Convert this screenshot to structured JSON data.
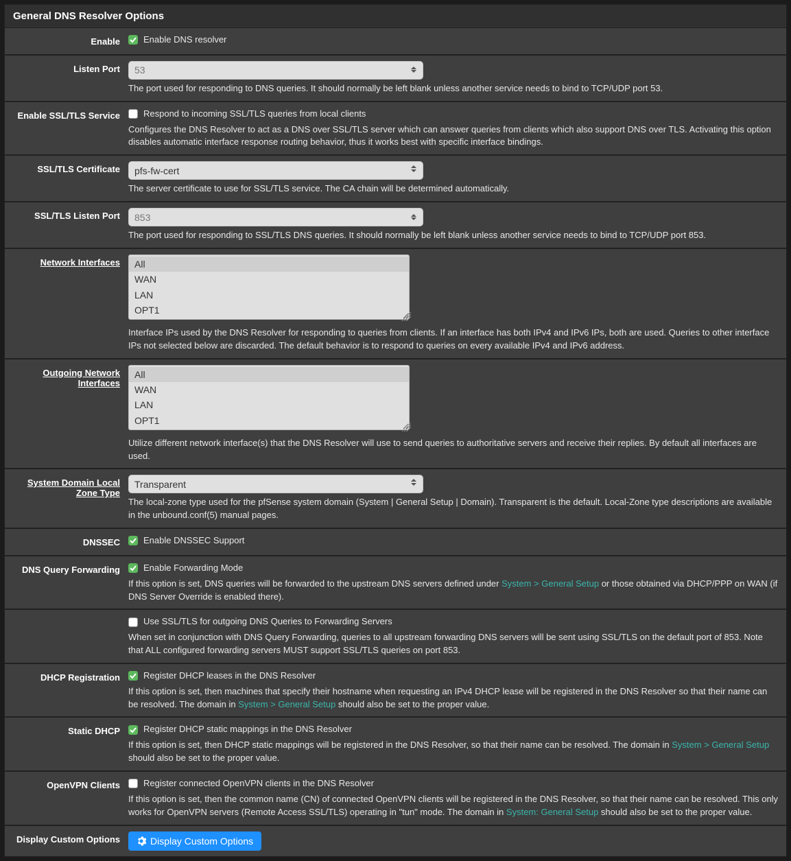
{
  "panel": {
    "title": "General DNS Resolver Options"
  },
  "fields": {
    "enable": {
      "label": "Enable",
      "check_label": "Enable DNS resolver",
      "checked": true
    },
    "listen_port": {
      "label": "Listen Port",
      "placeholder": "53",
      "value": "",
      "help": "The port used for responding to DNS queries. It should normally be left blank unless another service needs to bind to TCP/UDP port 53."
    },
    "enable_ssl": {
      "label": "Enable SSL/TLS Service",
      "check_label": "Respond to incoming SSL/TLS queries from local clients",
      "checked": false,
      "help": "Configures the DNS Resolver to act as a DNS over SSL/TLS server which can answer queries from clients which also support DNS over TLS. Activating this option disables automatic interface response routing behavior, thus it works best with specific interface bindings."
    },
    "ssl_cert": {
      "label": "SSL/TLS Certificate",
      "selected": "pfs-fw-cert",
      "help": "The server certificate to use for SSL/TLS service. The CA chain will be determined automatically."
    },
    "ssl_port": {
      "label": "SSL/TLS Listen Port",
      "placeholder": "853",
      "value": "",
      "help": "The port used for responding to SSL/TLS DNS queries. It should normally be left blank unless another service needs to bind to TCP/UDP port 853."
    },
    "net_if": {
      "label": "Network Interfaces",
      "options": [
        "All",
        "WAN",
        "LAN",
        "OPT1"
      ],
      "selected": [
        "All"
      ],
      "help": "Interface IPs used by the DNS Resolver for responding to queries from clients. If an interface has both IPv4 and IPv6 IPs, both are used. Queries to other interface IPs not selected below are discarded. The default behavior is to respond to queries on every available IPv4 and IPv6 address."
    },
    "out_if": {
      "label": "Outgoing Network Interfaces",
      "options": [
        "All",
        "WAN",
        "LAN",
        "OPT1"
      ],
      "selected": [
        "All"
      ],
      "help": "Utilize different network interface(s) that the DNS Resolver will use to send queries to authoritative servers and receive their replies. By default all interfaces are used."
    },
    "zone_type": {
      "label": "System Domain Local Zone Type",
      "selected": "Transparent",
      "help": "The local-zone type used for the pfSense system domain (System | General Setup | Domain). Transparent is the default. Local-Zone type descriptions are available in the unbound.conf(5) manual pages."
    },
    "dnssec": {
      "label": "DNSSEC",
      "check_label": "Enable DNSSEC Support",
      "checked": true
    },
    "forwarding": {
      "label": "DNS Query Forwarding",
      "check_label": "Enable Forwarding Mode",
      "checked": true,
      "help_pre": "If this option is set, DNS queries will be forwarded to the upstream DNS servers defined under ",
      "help_link": "System > General Setup",
      "help_post": " or those obtained via DHCP/PPP on WAN (if DNS Server Override is enabled there)."
    },
    "fwd_ssl": {
      "label": "",
      "check_label": "Use SSL/TLS for outgoing DNS Queries to Forwarding Servers",
      "checked": false,
      "help": "When set in conjunction with DNS Query Forwarding, queries to all upstream forwarding DNS servers will be sent using SSL/TLS on the default port of 853. Note that ALL configured forwarding servers MUST support SSL/TLS queries on port 853."
    },
    "dhcp_reg": {
      "label": "DHCP Registration",
      "check_label": "Register DHCP leases in the DNS Resolver",
      "checked": true,
      "help_pre": "If this option is set, then machines that specify their hostname when requesting an IPv4 DHCP lease will be registered in the DNS Resolver so that their name can be resolved. The domain in ",
      "help_link": "System > General Setup",
      "help_post": " should also be set to the proper value."
    },
    "static_dhcp": {
      "label": "Static DHCP",
      "check_label": "Register DHCP static mappings in the DNS Resolver",
      "checked": true,
      "help_pre": "If this option is set, then DHCP static mappings will be registered in the DNS Resolver, so that their name can be resolved. The domain in ",
      "help_link": "System > General Setup",
      "help_post": " should also be set to the proper value."
    },
    "openvpn": {
      "label": "OpenVPN Clients",
      "check_label": "Register connected OpenVPN clients in the DNS Resolver",
      "checked": false,
      "help_pre": "If this option is set, then the common name (CN) of connected OpenVPN clients will be registered in the DNS Resolver, so that their name can be resolved. This only works for OpenVPN servers (Remote Access SSL/TLS) operating in \"tun\" mode. The domain in ",
      "help_link": "System: General Setup",
      "help_post": " should also be set to the proper value."
    },
    "custom": {
      "label": "Display Custom Options",
      "button": "Display Custom Options"
    }
  }
}
